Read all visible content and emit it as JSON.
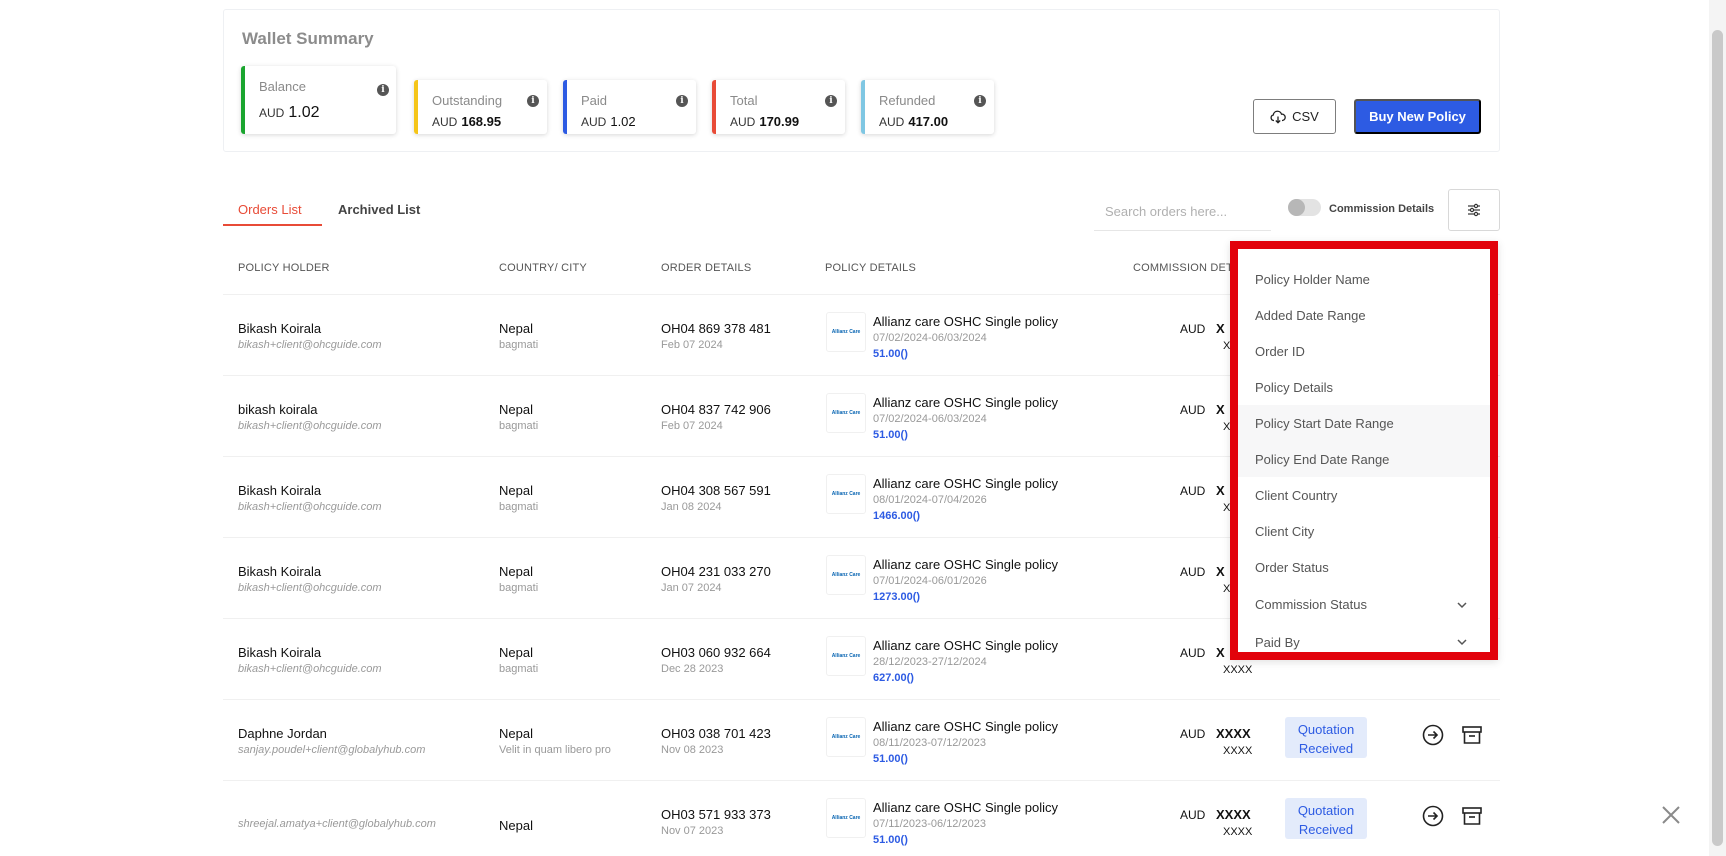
{
  "wallet": {
    "title": "Wallet Summary",
    "cards": [
      {
        "label": "Balance",
        "currency": "AUD",
        "amount": "1.02",
        "color": "#1aa52f"
      },
      {
        "label": "Outstanding",
        "currency": "AUD",
        "amount": "168.95",
        "color": "#f5c518"
      },
      {
        "label": "Paid",
        "currency": "AUD",
        "amount": "1.02",
        "color": "#2d5be3"
      },
      {
        "label": "Total",
        "currency": "AUD",
        "amount": "170.99",
        "color": "#e84b37"
      },
      {
        "label": "Refunded",
        "currency": "AUD",
        "amount": "417.00",
        "color": "#7fc7e3"
      }
    ],
    "csv_label": "CSV",
    "buy_label": "Buy New Policy"
  },
  "tabs": {
    "orders": "Orders List",
    "archived": "Archived List"
  },
  "search": {
    "placeholder": "Search orders here..."
  },
  "commission_toggle": {
    "label": "Commission Details",
    "on": false
  },
  "table": {
    "headers": {
      "holder": "POLICY HOLDER",
      "country": "COUNTRY/ CITY",
      "order": "ORDER DETAILS",
      "policy": "POLICY DETAILS",
      "commission": "COMMISSION DET"
    },
    "logo_text": "Allianz Care",
    "rows": [
      {
        "name": "Bikash Koirala",
        "email": "bikash+client@ohcguide.com",
        "country": "Nepal",
        "city": "bagmati",
        "order_id": "OH04 869 378 481",
        "order_date": "Feb 07 2024",
        "policy": "Allianz care OSHC Single policy",
        "dates": "07/02/2024-06/03/2024",
        "price": "51.00()",
        "comm_cur": "AUD",
        "comm_mask": "X",
        "comm_mask2": "X",
        "status": "",
        "actions": false
      },
      {
        "name": "bikash koirala",
        "email": "bikash+client@ohcguide.com",
        "country": "Nepal",
        "city": "bagmati",
        "order_id": "OH04 837 742 906",
        "order_date": "Feb 07 2024",
        "policy": "Allianz care OSHC Single policy",
        "dates": "07/02/2024-06/03/2024",
        "price": "51.00()",
        "comm_cur": "AUD",
        "comm_mask": "X",
        "comm_mask2": "X",
        "status": "",
        "actions": false
      },
      {
        "name": "Bikash Koirala",
        "email": "bikash+client@ohcguide.com",
        "country": "Nepal",
        "city": "bagmati",
        "order_id": "OH04 308 567 591",
        "order_date": "Jan 08 2024",
        "policy": "Allianz care OSHC Single policy",
        "dates": "08/01/2024-07/04/2026",
        "price": "1466.00()",
        "comm_cur": "AUD",
        "comm_mask": "X",
        "comm_mask2": "X",
        "status": "",
        "actions": false
      },
      {
        "name": "Bikash Koirala",
        "email": "bikash+client@ohcguide.com",
        "country": "Nepal",
        "city": "bagmati",
        "order_id": "OH04 231 033 270",
        "order_date": "Jan 07 2024",
        "policy": "Allianz care OSHC Single policy",
        "dates": "07/01/2024-06/01/2026",
        "price": "1273.00()",
        "comm_cur": "AUD",
        "comm_mask": "X",
        "comm_mask2": "X",
        "status": "",
        "actions": false
      },
      {
        "name": "Bikash Koirala",
        "email": "bikash+client@ohcguide.com",
        "country": "Nepal",
        "city": "bagmati",
        "order_id": "OH03 060 932 664",
        "order_date": "Dec 28 2023",
        "policy": "Allianz care OSHC Single policy",
        "dates": "28/12/2023-27/12/2024",
        "price": "627.00()",
        "comm_cur": "AUD",
        "comm_mask": "X",
        "comm_mask2": "XXXX",
        "status": "",
        "actions": false
      },
      {
        "name": "Daphne Jordan",
        "email": "sanjay.poudel+client@globalyhub.com",
        "country": "Nepal",
        "city": "Velit in quam libero pro",
        "order_id": "OH03 038 701 423",
        "order_date": "Nov 08 2023",
        "policy": "Allianz care OSHC Single policy",
        "dates": "08/11/2023-07/12/2023",
        "price": "51.00()",
        "comm_cur": "AUD",
        "comm_mask": "XXXX",
        "comm_mask2": "XXXX",
        "status": "Quotation Received",
        "actions": true
      },
      {
        "name": "",
        "email": "shreejal.amatya+client@globalyhub.com",
        "country": "Nepal",
        "city": "",
        "order_id": "OH03 571 933 373",
        "order_date": "Nov 07 2023",
        "policy": "Allianz care OSHC Single policy",
        "dates": "07/11/2023-06/12/2023",
        "price": "51.00()",
        "comm_cur": "AUD",
        "comm_mask": "XXXX",
        "comm_mask2": "XXXX",
        "status": "Quotation Received",
        "actions": true
      }
    ]
  },
  "filter_menu": {
    "items": [
      {
        "label": "Policy Holder Name",
        "has_chevron": false
      },
      {
        "label": "Added Date Range",
        "has_chevron": false
      },
      {
        "label": "Order ID",
        "has_chevron": false
      },
      {
        "label": "Policy Details",
        "has_chevron": false
      },
      {
        "label": "Policy Start Date Range",
        "has_chevron": false,
        "highlight": true
      },
      {
        "label": "Policy End Date Range",
        "has_chevron": false,
        "highlight": true
      },
      {
        "label": "Client Country",
        "has_chevron": false
      },
      {
        "label": "Client City",
        "has_chevron": false
      },
      {
        "label": "Order Status",
        "has_chevron": false
      },
      {
        "label": "Commission Status",
        "has_chevron": true
      },
      {
        "label": "Paid By",
        "has_chevron": true
      }
    ]
  },
  "colors": {
    "accent": "#2d5be3",
    "tab_active": "#e84b37",
    "highlight_border": "#e2020b",
    "badge_bg": "#e3ebfb"
  },
  "icons": {
    "info": "info-icon",
    "csv": "cloud-download-icon",
    "filter": "sliders-icon",
    "login": "arrow-right-circle-icon",
    "archive": "archive-box-icon",
    "close": "close-icon",
    "chevron": "chevron-down-icon"
  }
}
